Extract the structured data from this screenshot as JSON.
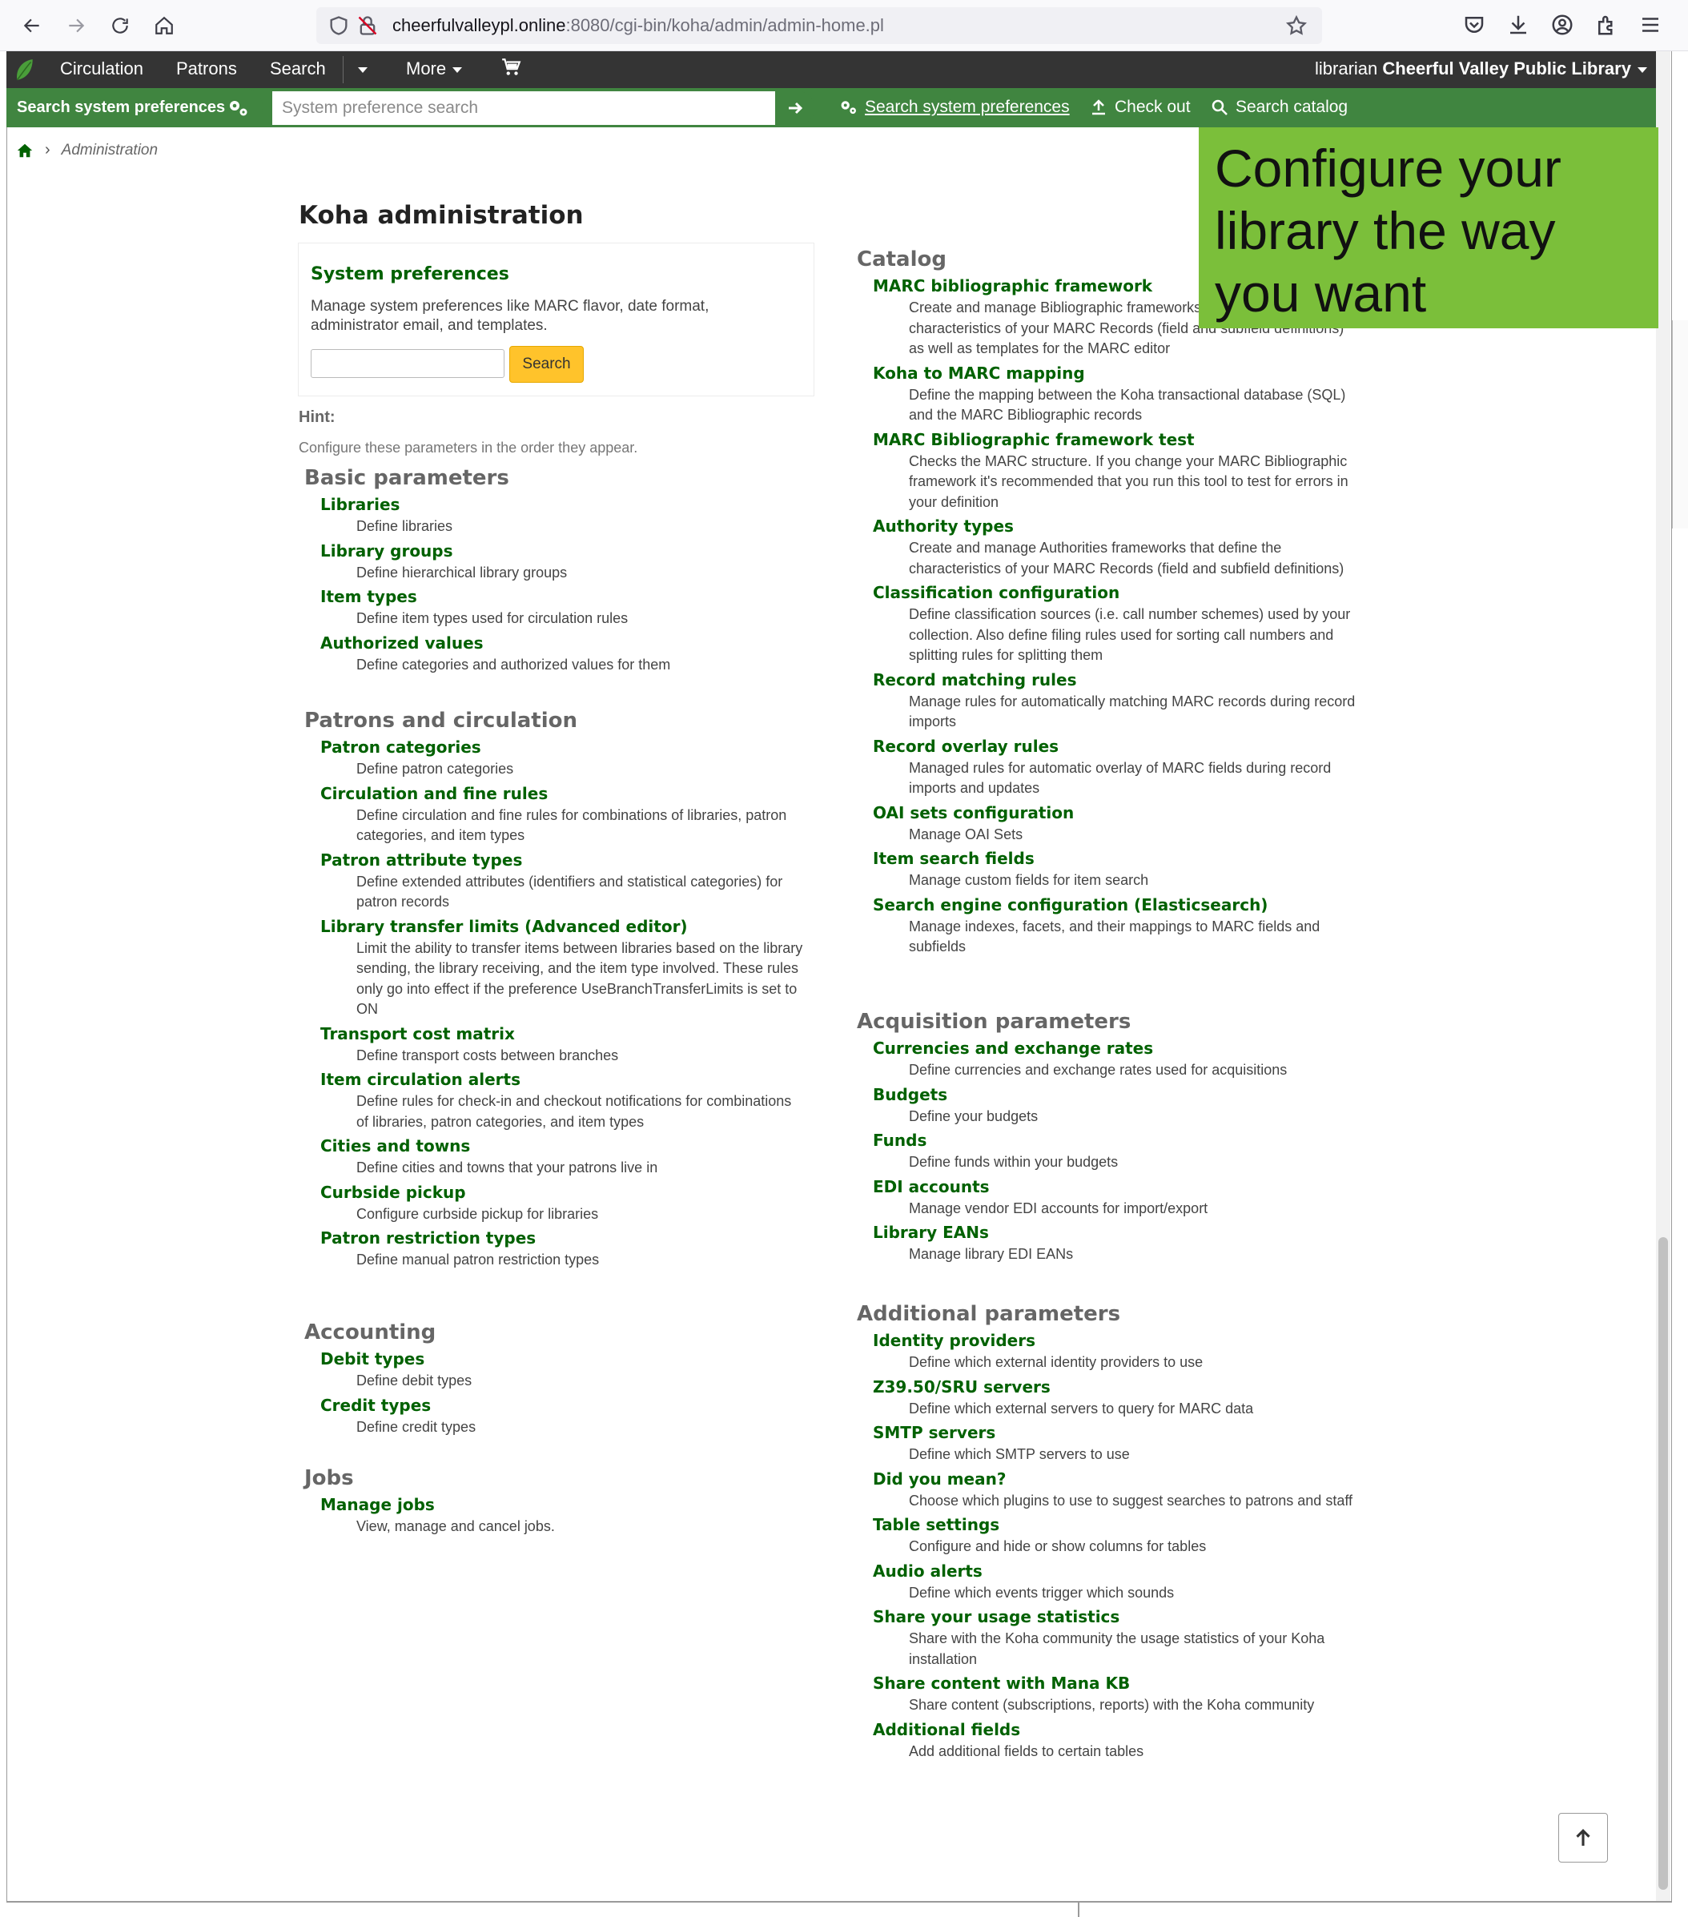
{
  "browser": {
    "url_host": "cheerfulvalleypl.online",
    "url_rest": ":8080/cgi-bin/koha/admin/admin-home.pl"
  },
  "header": {
    "nav": [
      "Circulation",
      "Patrons",
      "Search",
      "More"
    ],
    "user_role": "librarian",
    "library_name": "Cheerful Valley Public Library"
  },
  "searchbar": {
    "tab_label": "Search system preferences",
    "placeholder": "System preference search",
    "links": {
      "prefs": "Search system preferences",
      "checkout": "Check out",
      "catalog": "Search catalog"
    }
  },
  "breadcrumb": {
    "current": "Administration"
  },
  "banner": {
    "text": "Configure your library the way you want"
  },
  "main": {
    "title": "Koha administration",
    "sysprefs": {
      "title": "System preferences",
      "description": "Manage system preferences like MARC flavor, date format, administrator email, and templates.",
      "button": "Search"
    },
    "hint_label": "Hint:",
    "hint_text": "Configure these parameters in the order they appear.",
    "left_sections": [
      {
        "heading": "Basic parameters",
        "items": [
          {
            "label": "Libraries",
            "desc": "Define libraries"
          },
          {
            "label": "Library groups",
            "desc": "Define hierarchical library groups"
          },
          {
            "label": "Item types",
            "desc": "Define item types used for circulation rules"
          },
          {
            "label": "Authorized values",
            "desc": "Define categories and authorized values for them"
          }
        ]
      },
      {
        "heading": "Patrons and circulation",
        "items": [
          {
            "label": "Patron categories",
            "desc": "Define patron categories"
          },
          {
            "label": "Circulation and fine rules",
            "desc": "Define circulation and fine rules for combinations of libraries, patron categories, and item types"
          },
          {
            "label": "Patron attribute types",
            "desc": "Define extended attributes (identifiers and statistical categories) for patron records"
          },
          {
            "label": "Library transfer limits (Advanced editor)",
            "desc": "Limit the ability to transfer items between libraries based on the library sending, the library receiving, and the item type involved. These rules only go into effect if the preference UseBranchTransferLimits is set to ON"
          },
          {
            "label": "Transport cost matrix",
            "desc": "Define transport costs between branches"
          },
          {
            "label": "Item circulation alerts",
            "desc": "Define rules for check-in and checkout notifications for combinations of libraries, patron categories, and item types"
          },
          {
            "label": "Cities and towns",
            "desc": "Define cities and towns that your patrons live in"
          },
          {
            "label": "Curbside pickup",
            "desc": "Configure curbside pickup for libraries"
          },
          {
            "label": "Patron restriction types",
            "desc": "Define manual patron restriction types"
          }
        ]
      },
      {
        "heading": "Accounting",
        "items": [
          {
            "label": "Debit types",
            "desc": "Define debit types"
          },
          {
            "label": "Credit types",
            "desc": "Define credit types"
          }
        ]
      },
      {
        "heading": "Jobs",
        "items": [
          {
            "label": "Manage jobs",
            "desc": "View, manage and cancel jobs."
          }
        ]
      }
    ],
    "right_sections": [
      {
        "heading": "Catalog",
        "items": [
          {
            "label": "MARC bibliographic framework",
            "desc": "Create and manage Bibliographic frameworks that define the characteristics of your MARC Records (field and subfield definitions) as well as templates for the MARC editor"
          },
          {
            "label": "Koha to MARC mapping",
            "desc": "Define the mapping between the Koha transactional database (SQL) and the MARC Bibliographic records"
          },
          {
            "label": "MARC Bibliographic framework test",
            "desc": "Checks the MARC structure. If you change your MARC Bibliographic framework it's recommended that you run this tool to test for errors in your definition"
          },
          {
            "label": "Authority types",
            "desc": "Create and manage Authorities frameworks that define the characteristics of your MARC Records (field and subfield definitions)"
          },
          {
            "label": "Classification configuration",
            "desc": "Define classification sources (i.e. call number schemes) used by your collection. Also define filing rules used for sorting call numbers and splitting rules for splitting them"
          },
          {
            "label": "Record matching rules",
            "desc": "Manage rules for automatically matching MARC records during record imports"
          },
          {
            "label": "Record overlay rules",
            "desc": "Managed rules for automatic overlay of MARC fields during record imports and updates"
          },
          {
            "label": "OAI sets configuration",
            "desc": "Manage OAI Sets"
          },
          {
            "label": "Item search fields",
            "desc": "Manage custom fields for item search"
          },
          {
            "label": "Search engine configuration (Elasticsearch)",
            "desc": "Manage indexes, facets, and their mappings to MARC fields and subfields"
          }
        ]
      },
      {
        "heading": "Acquisition parameters",
        "items": [
          {
            "label": "Currencies and exchange rates",
            "desc": "Define currencies and exchange rates used for acquisitions"
          },
          {
            "label": "Budgets",
            "desc": "Define your budgets"
          },
          {
            "label": "Funds",
            "desc": "Define funds within your budgets"
          },
          {
            "label": "EDI accounts",
            "desc": "Manage vendor EDI accounts for import/export"
          },
          {
            "label": "Library EANs",
            "desc": "Manage library EDI EANs"
          }
        ]
      },
      {
        "heading": "Additional parameters",
        "items": [
          {
            "label": "Identity providers",
            "desc": "Define which external identity providers to use"
          },
          {
            "label": "Z39.50/SRU servers",
            "desc": "Define which external servers to query for MARC data"
          },
          {
            "label": "SMTP servers",
            "desc": "Define which SMTP servers to use"
          },
          {
            "label": "Did you mean?",
            "desc": "Choose which plugins to use to suggest searches to patrons and staff"
          },
          {
            "label": "Table settings",
            "desc": "Configure and hide or show columns for tables"
          },
          {
            "label": "Audio alerts",
            "desc": "Define which events trigger which sounds"
          },
          {
            "label": "Share your usage statistics",
            "desc": "Share with the Koha community the usage statistics of your Koha installation"
          },
          {
            "label": "Share content with Mana KB",
            "desc": "Share content (subscriptions, reports) with the Koha community"
          },
          {
            "label": "Additional fields",
            "desc": "Add additional fields to certain tables"
          }
        ]
      }
    ]
  },
  "colors": {
    "header_bg": "#343434",
    "searchbar_bg": "#408540",
    "link_green": "#006100",
    "banner_bg": "#7bbf3a",
    "search_button": "#ffc32b"
  },
  "icons": {
    "back": "arrow-left-icon",
    "forward": "arrow-right-icon",
    "reload": "reload-icon",
    "home": "home-icon",
    "cart": "cart-icon",
    "gear": "gears-icon",
    "checkout": "upload-icon",
    "catalog": "search-icon",
    "scroll_top": "arrow-up-icon"
  }
}
